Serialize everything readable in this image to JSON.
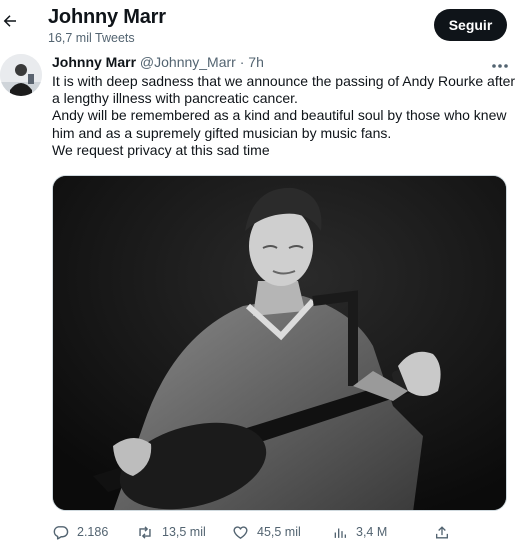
{
  "header": {
    "name": "Johnny Marr",
    "tweet_count": "16,7 mil Tweets",
    "follow_label": "Seguir"
  },
  "tweet": {
    "author_name": "Johnny Marr",
    "handle": "@Johnny_Marr",
    "separator": "·",
    "time": "7h",
    "paragraphs": [
      "It is with deep sadness that we announce the passing of Andy Rourke after a lengthy illness with pancreatic cancer.",
      "Andy will be remembered as a kind and beautiful soul by those who knew him and as a supremely gifted musician by music fans.",
      "We request privacy at this sad time"
    ]
  },
  "actions": {
    "replies": "2.186",
    "retweets": "13,5 mil",
    "likes": "45,5 mil",
    "views": "3,4 M"
  },
  "icons": {
    "back": "arrow-left-icon",
    "more": "more-horizontal-icon",
    "reply": "reply-icon",
    "retweet": "retweet-icon",
    "like": "heart-icon",
    "views": "views-chart-icon",
    "share": "share-icon"
  }
}
